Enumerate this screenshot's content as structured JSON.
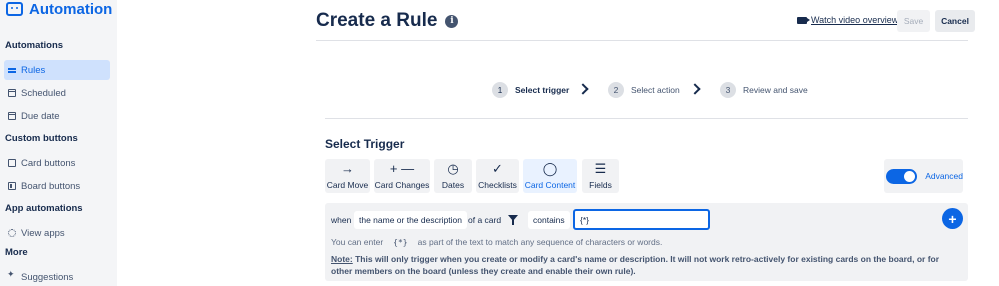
{
  "sidebar": {
    "brand": "Automation",
    "sections": [
      {
        "title": "Automations",
        "items": [
          {
            "label": "Rules",
            "icon": "rules-icon",
            "active": true
          },
          {
            "label": "Scheduled",
            "icon": "calendar-icon"
          },
          {
            "label": "Due date",
            "icon": "calendar-icon"
          }
        ]
      },
      {
        "title": "Custom buttons",
        "items": [
          {
            "label": "Card buttons",
            "icon": "card-icon"
          },
          {
            "label": "Board buttons",
            "icon": "board-icon"
          }
        ]
      },
      {
        "title": "App automations",
        "items": [
          {
            "label": "View apps",
            "icon": "gear-icon"
          }
        ]
      },
      {
        "title": "More",
        "items": [
          {
            "label": "Suggestions",
            "icon": "sparkle-icon"
          }
        ]
      }
    ]
  },
  "header": {
    "title": "Create a Rule",
    "video_link": "Watch video overview",
    "save_label": "Save",
    "cancel_label": "Cancel"
  },
  "steps": [
    {
      "num": "1",
      "label": "Select trigger",
      "active": true
    },
    {
      "num": "2",
      "label": "Select action",
      "active": false
    },
    {
      "num": "3",
      "label": "Review and save",
      "active": false
    }
  ],
  "trigger": {
    "title": "Select Trigger",
    "types": [
      {
        "label": "Card Move",
        "icon": "arrow-right-icon"
      },
      {
        "label": "Card Changes",
        "icon": "plus-minus-icon"
      },
      {
        "label": "Dates",
        "icon": "clock-icon"
      },
      {
        "label": "Checklists",
        "icon": "check-icon"
      },
      {
        "label": "Card Content",
        "icon": "comment-icon",
        "active": true
      },
      {
        "label": "Fields",
        "icon": "fields-icon"
      }
    ],
    "advanced_label": "Advanced",
    "advanced_on": true
  },
  "condition": {
    "when": "when",
    "field": "the name or the description",
    "of_a_card": "of a card",
    "operator": "contains",
    "input_value": "{*}",
    "hint_before": "You can enter",
    "hint_code": "{*}",
    "hint_after": "as part of the text to match any sequence of characters or words.",
    "note_label": "Note:",
    "note_text": "This will only trigger when you create or modify a card's name or description. It will not work retro-actively for existing cards on the board, or for other members on the board (unless they create and enable their own rule)."
  },
  "colors": {
    "accent": "#0c66e4",
    "text": "#172b4d",
    "panel": "#f1f2f4"
  }
}
